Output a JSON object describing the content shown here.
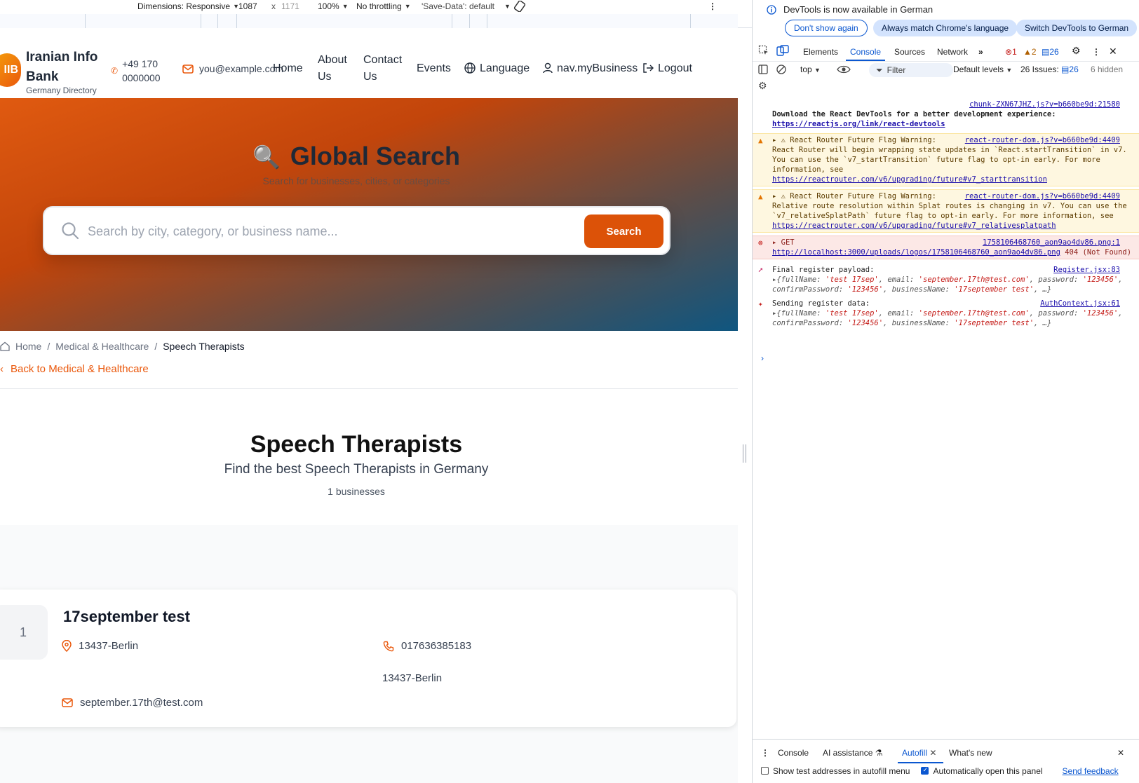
{
  "device_toolbar": {
    "dimensions_label": "Dimensions: Responsive",
    "width": "1087",
    "times": "x",
    "height": "1171",
    "zoom": "100%",
    "throttling": "No throttling",
    "save_data": "'Save-Data': default"
  },
  "site": {
    "logo_text": "IIB",
    "brand": "Iranian Info Bank",
    "brand_sub": "Germany Directory",
    "phone": "+49 170 0000000",
    "email": "you@example.com",
    "nav": {
      "home": "Home",
      "about": "About Us",
      "contact": "Contact Us",
      "events": "Events",
      "language": "Language",
      "my_business": "nav.myBusiness",
      "logout": "Logout"
    }
  },
  "hero": {
    "title": "Global Search",
    "subtitle": "Search for businesses, cities, or categories",
    "search_placeholder": "Search by city, category, or business name...",
    "search_button": "Search"
  },
  "breadcrumb": {
    "home": "Home",
    "category": "Medical & Healthcare",
    "current": "Speech Therapists",
    "separator": "/"
  },
  "back_link": "Back to Medical & Healthcare",
  "category": {
    "title": "Speech Therapists",
    "subtitle": "Find the best Speech Therapists in Germany",
    "count": "1 businesses"
  },
  "business": {
    "rank": "1",
    "name": "17september test",
    "location": "13437-Berlin",
    "phone": "017636385183",
    "address": "13437-Berlin",
    "email": "september.17th@test.com"
  },
  "devtools": {
    "info": "DevTools is now available in German",
    "btn_dont_show": "Don't show again",
    "btn_match": "Always match Chrome's language",
    "btn_switch": "Switch DevTools to German",
    "tabs": [
      "Elements",
      "Console",
      "Sources",
      "Network"
    ],
    "errors": "1",
    "warnings": "2",
    "issues_badge": "26",
    "context": "top",
    "filter": "Filter",
    "levels": "Default levels",
    "issues_label": "26 Issues:",
    "issues_count": "26",
    "hidden": "6 hidden",
    "console": {
      "m1_src": "chunk-ZXN67JHZ.js?v=b660be9d:21580",
      "m1_text": "Download the React DevTools for a better development experience:",
      "m1_link": "https://reactjs.org/link/react-devtools",
      "w1_head": "React Router Future Flag Warning:",
      "w1_src": "react-router-dom.js?v=b660be9d:4409",
      "w1_text": "React Router will begin wrapping state updates in `React.startTransition` in v7. You can use the `v7_startTransition` future flag to opt-in early. For more information, see",
      "w1_link": "https://reactrouter.com/v6/upgrading/future#v7_starttransition",
      "w2_head": "React Router Future Flag Warning:",
      "w2_src": "react-router-dom.js?v=b660be9d:4409",
      "w2_text": "Relative route resolution within Splat routes is changing in v7. You can use the `v7_relativeSplatPath` future flag to opt-in early. For more information, see",
      "w2_link": "https://reactrouter.com/v6/upgrading/future#v7_relativesplatpath",
      "e1_head": "GET",
      "e1_src": "1758106468760_aon9ao4dv86.png:1",
      "e1_link": "http://localhost:3000/uploads/logos/1758106468760_aon9ao4dv86.png",
      "e1_status": "404 (Not Found)",
      "l1_text": "Final register payload:",
      "l1_src": "Register.jsx:83",
      "l2_text": "Sending register data:",
      "l2_src": "AuthContext.jsx:61",
      "obj_fullName": "'test 17sep'",
      "obj_email": "'september.17th@test.com'",
      "obj_password": "'123456'",
      "obj_confirm": "'123456'",
      "obj_business": "'17september test'"
    },
    "drawer": {
      "tabs": [
        "Console",
        "AI assistance",
        "Autofill",
        "What's new"
      ],
      "opt1": "Show test addresses in autofill menu",
      "opt2": "Automatically open this panel",
      "feedback": "Send feedback"
    }
  }
}
